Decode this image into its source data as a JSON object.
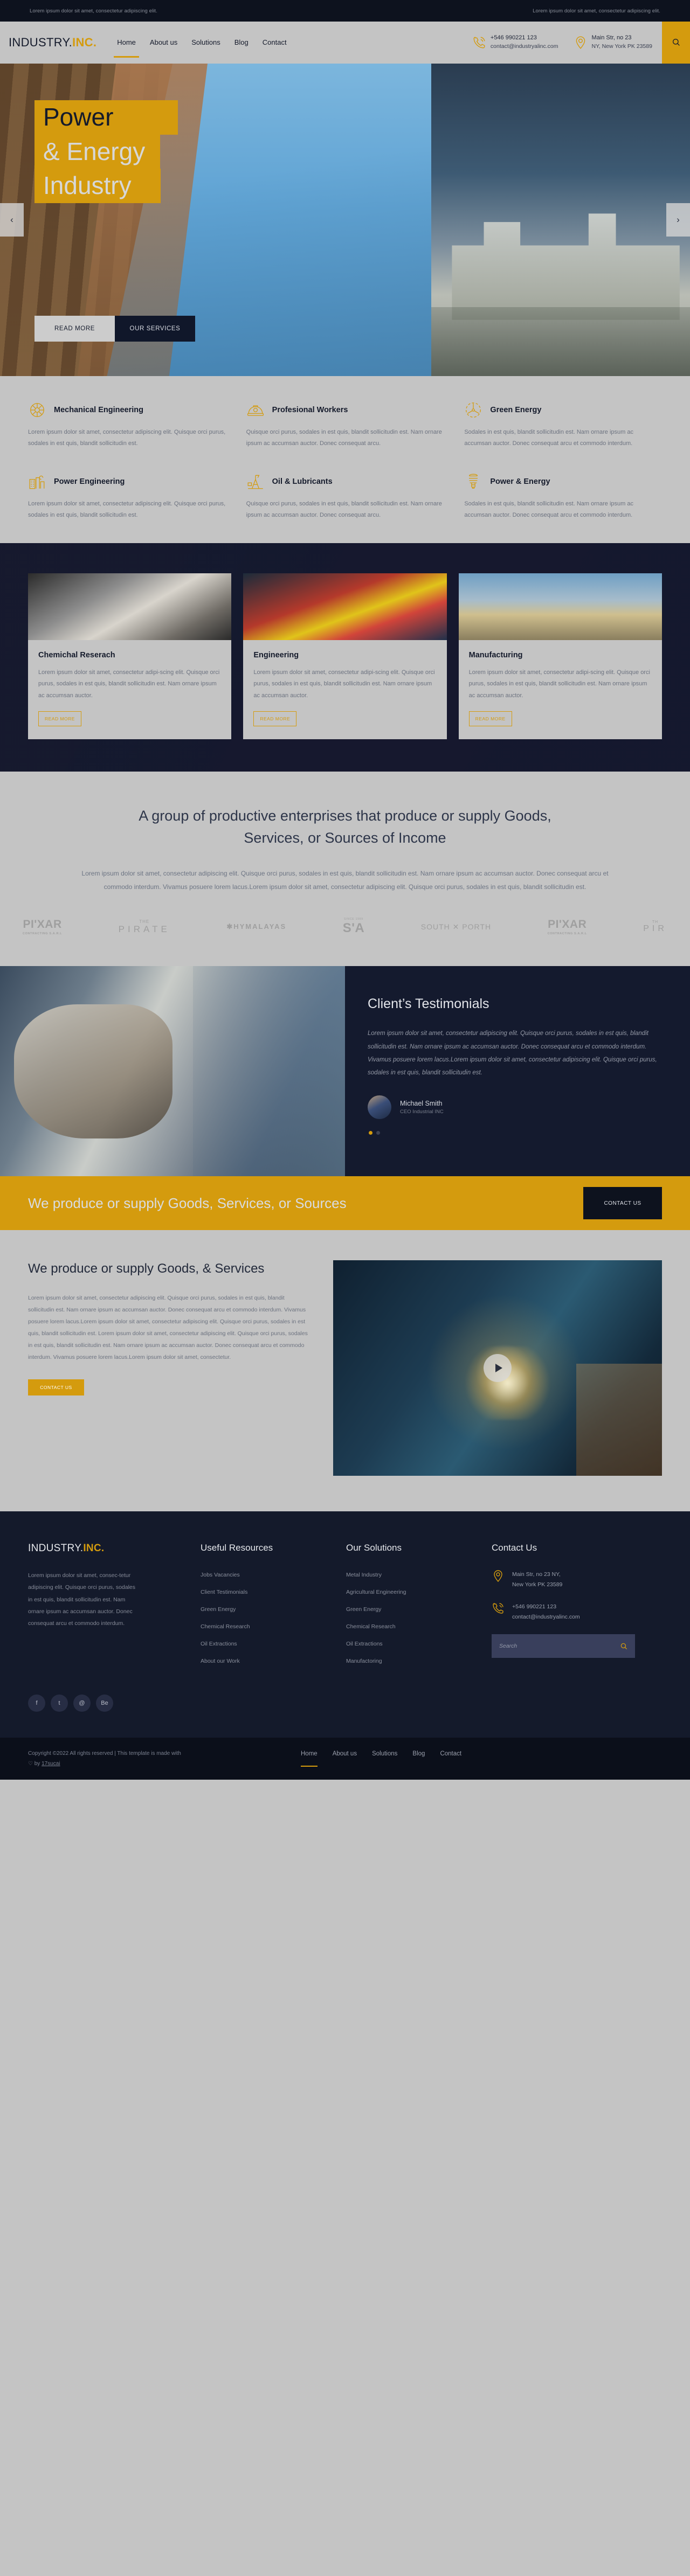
{
  "topbar": {
    "left": "Lorem ipsum dolor sit amet, consectetur adipiscing elit.",
    "right": "Lorem ipsum dolor sit amet, consectetur adipiscing elit."
  },
  "header": {
    "logo_main": "INDUSTRY.",
    "logo_accent": "INC.",
    "nav": [
      {
        "label": "Home",
        "active": true
      },
      {
        "label": "About us",
        "active": false
      },
      {
        "label": "Solutions",
        "active": false
      },
      {
        "label": "Blog",
        "active": false
      },
      {
        "label": "Contact",
        "active": false
      }
    ],
    "phone": "+546 990221 123",
    "email": "contact@industryalinc.com",
    "address_line1": "Main Str, no 23",
    "address_line2": "NY, New York PK 23589",
    "search_icon": "search-icon",
    "phone_icon": "phone-icon",
    "location_icon": "location-pin-icon"
  },
  "hero": {
    "line1": "Power",
    "line2": "& Energy",
    "line3": "Industry",
    "btn_primary": "READ MORE",
    "btn_secondary": "OUR SERVICES",
    "prev_icon": "chevron-left-icon",
    "next_icon": "chevron-right-icon"
  },
  "services": [
    {
      "icon": "gear-icon",
      "title": "Mechanical Engineering",
      "text": "Lorem ipsum dolor sit amet, consectetur adipiscing elit. Quisque orci purus, sodales in est quis, blandit sollicitudin est."
    },
    {
      "icon": "hard-hat-icon",
      "title": "Profesional Workers",
      "text": "Quisque orci purus, sodales in est quis, blandit sollicitudin est. Nam ornare ipsum ac accumsan auctor. Donec consequat arcu."
    },
    {
      "icon": "wind-turbine-icon",
      "title": "Green Energy",
      "text": "Sodales in est quis, blandit sollicitudin est. Nam ornare ipsum ac accumsan auctor. Donec consequat arcu et commodo interdum."
    },
    {
      "icon": "factory-icon",
      "title": "Power Engineering",
      "text": "Lorem ipsum dolor sit amet, consectetur adipiscing elit. Quisque orci purus, sodales in est quis, blandit sollicitudin est."
    },
    {
      "icon": "oil-pump-icon",
      "title": "Oil & Lubricants",
      "text": "Quisque orci purus, sodales in est quis, blandit sollicitudin est. Nam ornare ipsum ac accumsan auctor. Donec consequat arcu."
    },
    {
      "icon": "light-bulb-icon",
      "title": "Power & Energy",
      "text": "Sodales in est quis, blandit sollicitudin est. Nam ornare ipsum ac accumsan auctor. Donec consequat arcu et commodo interdum."
    }
  ],
  "cards": [
    {
      "title": "Chemichal Reserach",
      "text": "Lorem ipsum dolor sit amet, consectetur adipi-scing elit. Quisque orci purus, sodales in est quis, blandit sollicitudin est. Nam ornare ipsum ac accumsan auctor.",
      "button": "READ MORE"
    },
    {
      "title": "Engineering",
      "text": "Lorem ipsum dolor sit amet, consectetur adipi-scing elit. Quisque orci purus, sodales in est quis, blandit sollicitudin est. Nam ornare ipsum ac accumsan auctor.",
      "button": "READ MORE"
    },
    {
      "title": "Manufacturing",
      "text": "Lorem ipsum dolor sit amet, consectetur adipi-scing elit. Quisque orci purus, sodales in est quis, blandit sollicitudin est. Nam ornare ipsum ac accumsan auctor.",
      "button": "READ MORE"
    }
  ],
  "group": {
    "title": "A group of productive enterprises that produce or supply Goods, Services, or Sources of Income",
    "text": "Lorem ipsum dolor sit amet, consectetur adipiscing elit. Quisque orci purus, sodales in est quis, blandit sollicitudin est. Nam ornare ipsum ac accumsan auctor. Donec consequat arcu et commodo interdum. Vivamus posuere lorem lacus.Lorem ipsum dolor sit amet, consectetur adipiscing elit. Quisque orci purus, sodales in est quis, blandit sollicitudin est.",
    "brands": [
      {
        "kind": "pixar",
        "big": "PI'XAR",
        "sub": "CONTRACTING S.A.R.L"
      },
      {
        "kind": "pirate",
        "top": "THE",
        "mid": "PIRATE"
      },
      {
        "kind": "hym",
        "big": "HYMALAYAS"
      },
      {
        "kind": "sa",
        "since": "SINCE 1969",
        "big": "S'A"
      },
      {
        "kind": "south",
        "big": "SOUTH ✕ PORTH"
      },
      {
        "kind": "pixar",
        "big": "PI'XAR",
        "sub": "CONTRACTING S.A.R.L"
      },
      {
        "kind": "pir",
        "top": "TH",
        "mid": "PIR"
      }
    ]
  },
  "testimonials": {
    "title": "Client’s Testimonials",
    "quote": "Lorem ipsum dolor sit amet, consectetur adipiscing elit. Quisque orci purus, sodales in est quis, blandit sollicitudin est. Nam ornare ipsum ac accumsan auctor. Donec consequat arcu et commodo interdum. Vivamus posuere lorem lacus.Lorem ipsum dolor sit amet, consectetur adipiscing elit. Quisque orci purus, sodales in est quis, blandit sollicitudin est.",
    "name": "Michael Smith",
    "role": "CEO Industrial INC",
    "dots": 2,
    "active_dot": 0
  },
  "cta": {
    "text": "We produce or supply Goods, Services, or Sources",
    "button": "CONTACT US"
  },
  "produce": {
    "title": "We produce or supply Goods, & Services",
    "text": "Lorem ipsum dolor sit amet, consectetur adipiscing elit. Quisque orci purus, sodales in est quis, blandit sollicitudin est. Nam ornare ipsum ac accumsan auctor. Donec consequat arcu et commodo interdum. Vivamus posuere lorem lacus.Lorem ipsum dolor sit amet, consectetur adipiscing elit. Quisque orci purus, sodales in est quis, blandit sollicitudin est. Lorem ipsum dolor sit amet, consectetur adipiscing elit. Quisque orci purus, sodales in est quis, blandit sollicitudin est. Nam ornare ipsum ac accumsan auctor. Donec consequat arcu et commodo interdum. Vivamus posuere lorem lacus.Lorem ipsum dolor sit amet, consectetur.",
    "button": "CONTACT US",
    "play_icon": "play-icon"
  },
  "footer": {
    "logo_main": "INDUSTRY.",
    "logo_accent": "INC.",
    "about": "Lorem ipsum dolor sit amet, consec-tetur adipiscing elit. Quisque orci purus, sodales in est quis, blandit sollicitudin est. Nam ornare ipsum ac accumsan auctor. Donec consequat arcu et commodo interdum.",
    "resources_title": "Useful Resources",
    "resources": [
      "Jobs Vacancies",
      "Client Testimonials",
      "Green Energy",
      "Chemical Research",
      "Oil Extractions",
      "About our Work"
    ],
    "solutions_title": "Our Solutions",
    "solutions": [
      "Metal Industry",
      "Agricultural Engineering",
      "Green Energy",
      "Chemical Research",
      "Oil Extractions",
      "Manufactoring"
    ],
    "contact_title": "Contact Us",
    "address_line1": "Main Str, no 23 NY,",
    "address_line2": "New York PK 23589",
    "phone": "+546 990221 123",
    "email": "contact@industryalinc.com",
    "search_placeholder": "Search",
    "socials": [
      "f",
      "t",
      "@",
      "Be"
    ],
    "copyright": "Copyright ©2022 All rights reserved | This template is made with ♡ by ",
    "copyright_link": "17sucai",
    "bottom_nav": [
      {
        "label": "Home",
        "active": true
      },
      {
        "label": "About us",
        "active": false
      },
      {
        "label": "Solutions",
        "active": false
      },
      {
        "label": "Blog",
        "active": false
      },
      {
        "label": "Contact",
        "active": false
      }
    ]
  },
  "colors": {
    "accent": "#d49b0e",
    "dark": "#141a2b",
    "light": "#c4c4c4"
  }
}
